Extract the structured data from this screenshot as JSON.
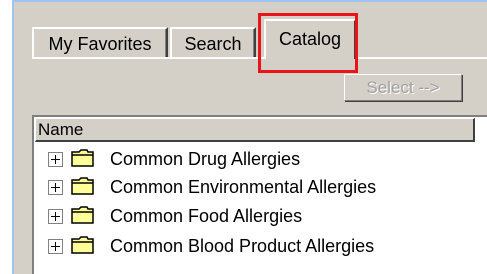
{
  "tabs": [
    {
      "label": "My Favorites",
      "active": false
    },
    {
      "label": "Search",
      "active": false
    },
    {
      "label": "Catalog",
      "active": true
    }
  ],
  "toolbar": {
    "select_label": "Select -->",
    "select_enabled": false
  },
  "list": {
    "column_header": "Name",
    "items": [
      {
        "label": "Common Drug Allergies",
        "icon": "folder-icon",
        "expander": "plus"
      },
      {
        "label": "Common Environmental Allergies",
        "icon": "folder-icon",
        "expander": "plus"
      },
      {
        "label": "Common Food Allergies",
        "icon": "folder-icon",
        "expander": "plus"
      },
      {
        "label": "Common Blood Product Allergies",
        "icon": "folder-icon",
        "expander": "plus"
      }
    ]
  },
  "colors": {
    "highlight": "#e8141a",
    "folder_fill": "#ffff99",
    "window_bg": "#d4d0c8"
  }
}
